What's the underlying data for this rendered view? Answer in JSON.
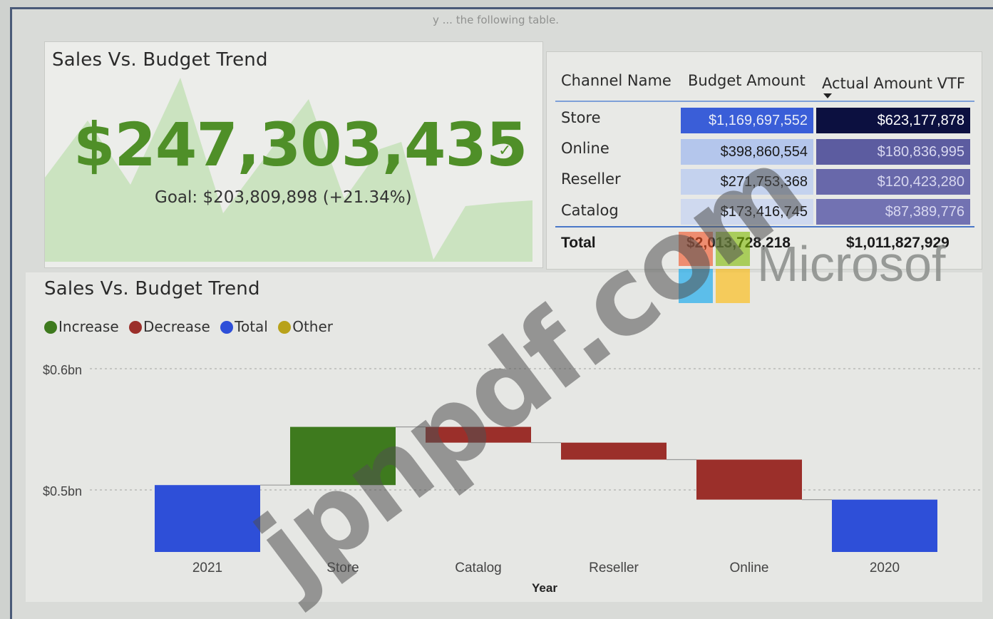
{
  "top_caption": "y ... the following table.",
  "kpi": {
    "title": "Sales Vs. Budget Trend",
    "value": "$247,303,435",
    "goal_text": "Goal: $203,809,898 (+21.34%)",
    "value_color": "#4f8f28"
  },
  "matrix": {
    "headers": [
      "Channel Name",
      "Budget Amount",
      "Actual Amount VTF"
    ],
    "rows": [
      {
        "channel": "Store",
        "budget": "$1,169,697,552",
        "actual": "$623,177,878",
        "budget_color": "#3a5ed8",
        "actual_color": "#0c1040"
      },
      {
        "channel": "Online",
        "budget": "$398,860,554",
        "actual": "$180,836,995",
        "budget_color": "#b4c6ec",
        "actual_color": "#5c5ca0"
      },
      {
        "channel": "Reseller",
        "budget": "$271,753,368",
        "actual": "$120,423,280",
        "budget_color": "#c4d2ee",
        "actual_color": "#6868aa"
      },
      {
        "channel": "Catalog",
        "budget": "$173,416,745",
        "actual": "$87,389,776",
        "budget_color": "#cfd9ef",
        "actual_color": "#7272b2"
      }
    ],
    "total_label": "Total",
    "total_budget": "$2,013,728,218",
    "total_actual": "$1,011,827,929"
  },
  "waterfall": {
    "title": "Sales Vs. Budget Trend",
    "legend": [
      {
        "label": "Increase",
        "color": "#3e7a1e"
      },
      {
        "label": "Decrease",
        "color": "#9b2f2a"
      },
      {
        "label": "Total",
        "color": "#2e4fd8"
      },
      {
        "label": "Other",
        "color": "#b8a21a"
      }
    ]
  },
  "chart_data": {
    "type": "bar",
    "subtype": "waterfall",
    "title": "Sales Vs. Budget Trend",
    "xlabel": "Year",
    "ylabel": "",
    "categories": [
      "2021",
      "Store",
      "Catalog",
      "Reseller",
      "Online",
      "2020"
    ],
    "steps": [
      {
        "category": "2021",
        "kind": "Total",
        "start": 0,
        "end": 0.504
      },
      {
        "category": "Store",
        "kind": "Increase",
        "start": 0.504,
        "end": 0.552
      },
      {
        "category": "Catalog",
        "kind": "Decrease",
        "start": 0.552,
        "end": 0.539
      },
      {
        "category": "Reseller",
        "kind": "Decrease",
        "start": 0.539,
        "end": 0.525
      },
      {
        "category": "Online",
        "kind": "Decrease",
        "start": 0.525,
        "end": 0.492
      },
      {
        "category": "2020",
        "kind": "Total",
        "start": 0,
        "end": 0.492
      }
    ],
    "ylim": [
      0.45,
      0.6
    ],
    "yticks": [
      {
        "value": 0.5,
        "label": "$0.5bn"
      },
      {
        "value": 0.6,
        "label": "$0.6bn"
      }
    ],
    "grid": true,
    "legend_position": "top-left"
  },
  "logo": {
    "word": "Microsof",
    "colors": [
      "#f25022",
      "#7fba00",
      "#00a4ef",
      "#ffb900"
    ]
  },
  "watermark": "jpnpdf.com"
}
